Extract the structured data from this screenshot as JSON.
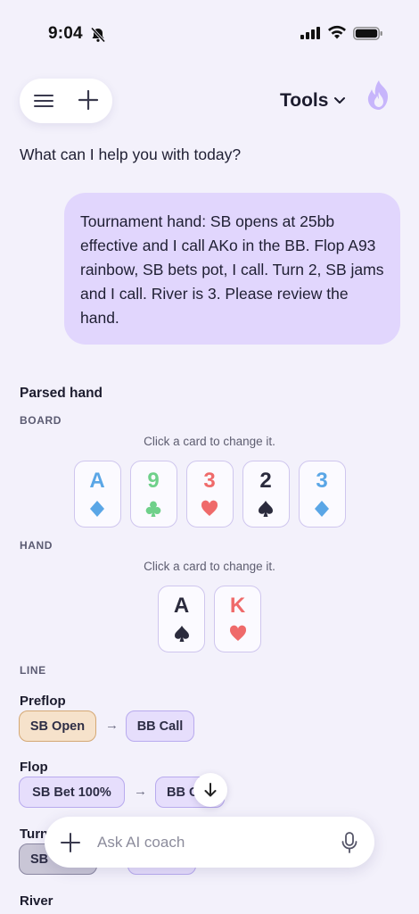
{
  "status_bar": {
    "time": "9:04"
  },
  "header": {
    "tools_label": "Tools"
  },
  "greeting": "What can I help you with today?",
  "user_message": "Tournament hand: SB opens at 25bb effective and I call AKo in the BB. Flop A93 rainbow, SB bets pot, I call. Turn 2, SB jams and I call. River is 3. Please review the hand.",
  "parsed_hand": {
    "title": "Parsed hand",
    "board_label": "BOARD",
    "board_hint": "Click a card to change it.",
    "board": [
      {
        "rank": "A",
        "suit": "diamond",
        "color": "#5aa6e6"
      },
      {
        "rank": "9",
        "suit": "club",
        "color": "#6fd08a"
      },
      {
        "rank": "3",
        "suit": "heart",
        "color": "#ef6a6a"
      },
      {
        "rank": "2",
        "suit": "spade",
        "color": "#2b2b3d"
      },
      {
        "rank": "3",
        "suit": "diamond",
        "color": "#5aa6e6"
      }
    ],
    "hand_label": "HAND",
    "hand_hint": "Click a card to change it.",
    "hand": [
      {
        "rank": "A",
        "suit": "spade",
        "color": "#2b2b3d"
      },
      {
        "rank": "K",
        "suit": "heart",
        "color": "#ef6a6a"
      }
    ],
    "line_label": "LINE",
    "streets": {
      "preflop": {
        "name": "Preflop",
        "actions": [
          "SB Open",
          "BB Call"
        ]
      },
      "flop": {
        "name": "Flop",
        "actions": [
          "SB Bet 100%",
          "BB C"
        ]
      },
      "turn": {
        "name": "Turn",
        "actions": [
          "SB"
        ]
      },
      "river": {
        "name": "River"
      }
    },
    "arrow_glyph": "→"
  },
  "composer": {
    "placeholder": "Ask AI coach"
  },
  "colors": {
    "accent": "#e1d6fd",
    "background": "#f3f1fb",
    "hero_chip": "#f6e2cb",
    "flame": "#c7b5fb"
  }
}
